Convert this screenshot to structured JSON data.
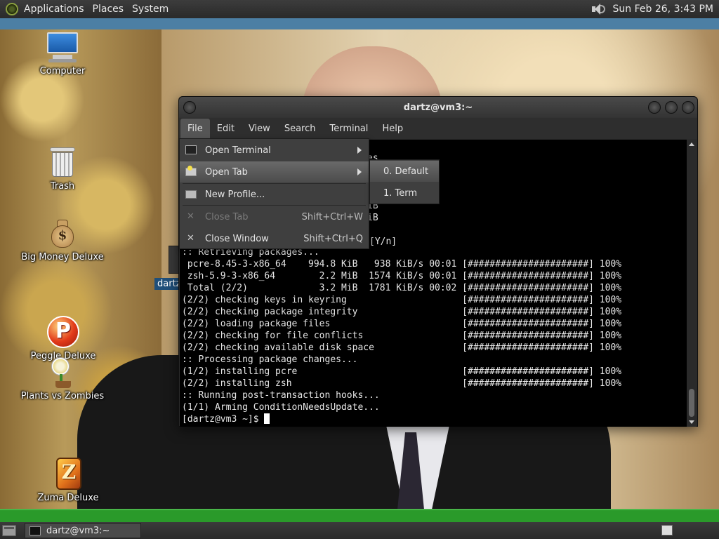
{
  "top_panel": {
    "menus": [
      "Applications",
      "Places",
      "System"
    ],
    "clock": "Sun Feb 26,  3:43 PM",
    "volume_icon": "speaker-icon"
  },
  "desktop_icons": [
    {
      "label": "Computer",
      "icon": "computer-icon"
    },
    {
      "label": "Trash",
      "icon": "trash-icon"
    },
    {
      "label": "Big Money Deluxe",
      "icon": "money-bag-icon"
    },
    {
      "label": "Peggle Deluxe",
      "icon": "peggle-icon"
    },
    {
      "label": "Plants vs Zombies",
      "icon": "plants-vs-zombies-icon"
    },
    {
      "label": "Zuma Deluxe",
      "icon": "zuma-icon"
    }
  ],
  "background_window": {
    "label": "dartz"
  },
  "terminal": {
    "title": "dartz@vm3:~",
    "menubar": [
      "File",
      "Edit",
      "View",
      "Search",
      "Terminal",
      "Help"
    ],
    "partial_lines": [
      "es...",
      "iB",
      "iB",
      "[Y/n]"
    ],
    "lines": [
      ":: Retrieving packages...",
      " pcre-8.45-3-x86_64    994.8 KiB   938 KiB/s 00:01 [######################] 100%",
      " zsh-5.9-3-x86_64        2.2 MiB  1574 KiB/s 00:01 [######################] 100%",
      " Total (2/2)             3.2 MiB  1781 KiB/s 00:02 [######################] 100%",
      "(2/2) checking keys in keyring                     [######################] 100%",
      "(2/2) checking package integrity                   [######################] 100%",
      "(2/2) loading package files                        [######################] 100%",
      "(2/2) checking for file conflicts                  [######################] 100%",
      "(2/2) checking available disk space                [######################] 100%",
      ":: Processing package changes...",
      "(1/2) installing pcre                              [######################] 100%",
      "(2/2) installing zsh                               [######################] 100%",
      ":: Running post-transaction hooks...",
      "(1/1) Arming ConditionNeedsUpdate..."
    ],
    "prompt": "[dartz@vm3 ~]$ "
  },
  "file_menu": {
    "items": [
      {
        "label": "Open Terminal",
        "shortcut": "",
        "submenu": true,
        "enabled": true,
        "icon": "terminal-icon"
      },
      {
        "label": "Open Tab",
        "shortcut": "",
        "submenu": true,
        "enabled": true,
        "icon": "tab-icon"
      },
      {
        "label": "New Profile...",
        "shortcut": "",
        "submenu": false,
        "enabled": true,
        "icon": "profile-icon"
      },
      {
        "label": "Close Tab",
        "shortcut": "Shift+Ctrl+W",
        "submenu": false,
        "enabled": false,
        "icon": "close-icon"
      },
      {
        "label": "Close Window",
        "shortcut": "Shift+Ctrl+Q",
        "submenu": false,
        "enabled": true,
        "icon": "close-icon"
      }
    ]
  },
  "open_tab_submenu": {
    "items": [
      "0. Default",
      "1. Term"
    ]
  },
  "bottom_panel": {
    "taskbar_item": "dartz@vm3:~"
  },
  "colors": {
    "panel": "#2e2e2e",
    "terminal_bg": "#000000",
    "green_bar": "#2a9a2a",
    "top_band": "#4c7fa4"
  }
}
